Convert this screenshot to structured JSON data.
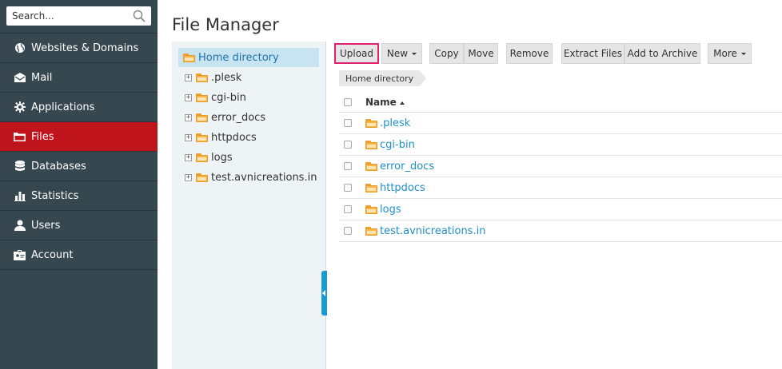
{
  "search": {
    "placeholder": "Search..."
  },
  "sidebar": {
    "items": [
      {
        "label": "Websites & Domains",
        "icon": "globe-icon"
      },
      {
        "label": "Mail",
        "icon": "envelope-icon"
      },
      {
        "label": "Applications",
        "icon": "gear-icon"
      },
      {
        "label": "Files",
        "icon": "folder-icon",
        "active": true
      },
      {
        "label": "Databases",
        "icon": "database-icon"
      },
      {
        "label": "Statistics",
        "icon": "bar-chart-icon"
      },
      {
        "label": "Users",
        "icon": "user-icon"
      },
      {
        "label": "Account",
        "icon": "account-icon"
      }
    ]
  },
  "page": {
    "title": "File Manager"
  },
  "tree": {
    "root": "Home directory",
    "items": [
      ".plesk",
      "cgi-bin",
      "error_docs",
      "httpdocs",
      "logs",
      "test.avnicreations.in"
    ]
  },
  "toolbar": {
    "upload": "Upload",
    "new": "New",
    "copy": "Copy",
    "move": "Move",
    "remove": "Remove",
    "extract": "Extract Files",
    "archive": "Add to Archive",
    "more": "More"
  },
  "breadcrumb": "Home directory",
  "table": {
    "header_name": "Name",
    "rows": [
      ".plesk",
      "cgi-bin",
      "error_docs",
      "httpdocs",
      "logs",
      "test.avnicreations.in"
    ]
  },
  "colors": {
    "sidebar_bg": "#37474f",
    "active_nav": "#c0141c",
    "link": "#1f8fc8",
    "highlight_border": "#e0226e"
  }
}
